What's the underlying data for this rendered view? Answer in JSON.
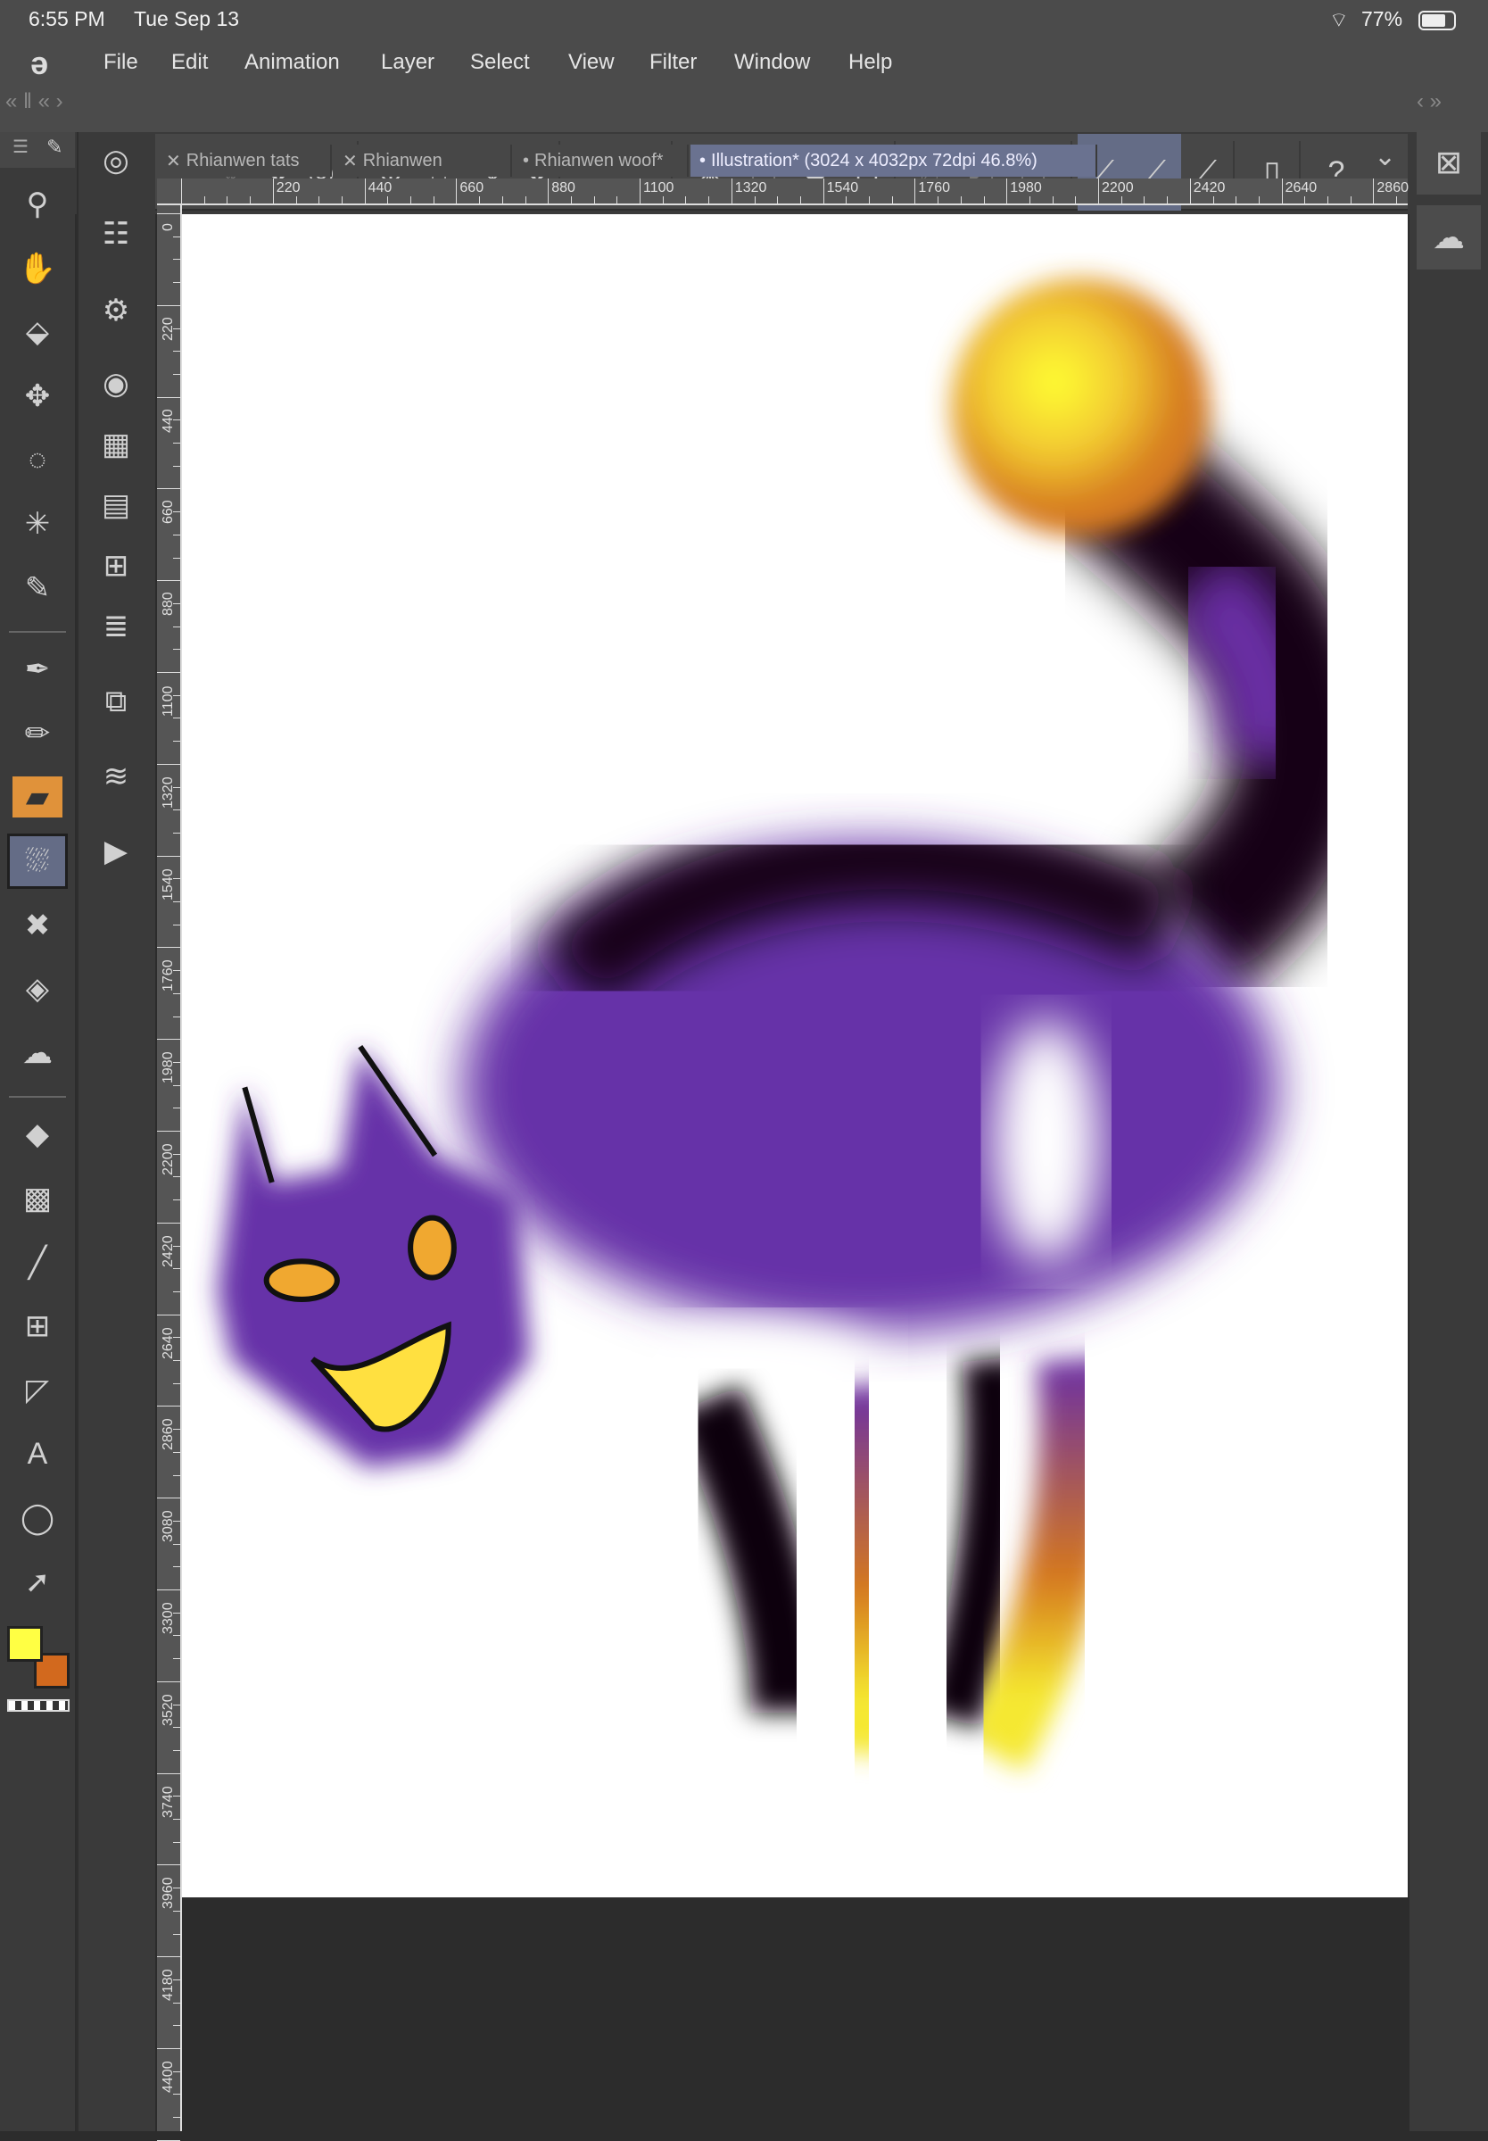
{
  "status": {
    "time": "6:55 PM",
    "date": "Tue Sep 13",
    "battery": "77%",
    "wifi_icon": "wifi-icon",
    "battery_icon": "battery-icon"
  },
  "menu": [
    "File",
    "Edit",
    "Animation",
    "Layer",
    "Select",
    "View",
    "Filter",
    "Window",
    "Help"
  ],
  "command_bar": [
    {
      "name": "menu-icon",
      "glyph": "☰"
    },
    {
      "name": "edit-layer-icon",
      "glyph": "✐",
      "dim": true
    },
    {
      "name": "updown-icon",
      "glyph": "⇕"
    },
    {
      "name": "clip-studio-sync-icon",
      "glyph": "◎"
    },
    {
      "name": "new-icon",
      "glyph": "⊕"
    },
    {
      "name": "open-icon",
      "glyph": "⌂"
    },
    {
      "name": "save-icon",
      "glyph": "⤓"
    },
    {
      "name": "updown-icon-2",
      "glyph": "⇕"
    },
    {
      "name": "undo-icon",
      "glyph": "↶"
    },
    {
      "name": "redo-icon",
      "glyph": "↷",
      "dim": true
    },
    {
      "name": "deselect-icon",
      "glyph": "✺"
    },
    {
      "name": "select-all-icon",
      "glyph": "⬚",
      "dim": true
    },
    {
      "name": "fill-icon",
      "glyph": "◆"
    },
    {
      "name": "transform-icon",
      "glyph": "⊡"
    },
    {
      "name": "clear-icon",
      "glyph": "⍁",
      "dim": true
    },
    {
      "name": "fill-selection-icon",
      "glyph": "◩",
      "dim": true
    },
    {
      "name": "border-icon",
      "glyph": "▢",
      "dim": true
    },
    {
      "name": "snap-ruler-icon",
      "glyph": "⟋",
      "hl": true
    },
    {
      "name": "snap-special-ruler-icon",
      "glyph": "⟋",
      "hl": true
    },
    {
      "name": "snap-grid-icon",
      "glyph": "⟋"
    },
    {
      "name": "device-icon",
      "glyph": "▯"
    },
    {
      "name": "help-icon",
      "glyph": "?"
    }
  ],
  "tabs": [
    {
      "label": "Rhianwen tats",
      "mark": "✕"
    },
    {
      "label": "Rhianwen",
      "mark": "✕"
    },
    {
      "label": "Rhianwen woof*",
      "mark": "•"
    },
    {
      "label": "Illustration* (3024 x 4032px 72dpi 46.8%)",
      "mark": "•",
      "active": true
    }
  ],
  "tabs_dropdown": "⌄",
  "ruler_h": [
    "220",
    "440",
    "660",
    "880",
    "1100",
    "1320",
    "1540",
    "1760",
    "1980",
    "2200",
    "2420",
    "2640",
    "2860"
  ],
  "ruler_v": [
    "0",
    "220",
    "440",
    "660",
    "880",
    "1100",
    "1320",
    "1540",
    "1760",
    "1980",
    "2200",
    "2420",
    "2640",
    "2860",
    "3080",
    "3300",
    "3520",
    "3740",
    "3960",
    "4180",
    "4400"
  ],
  "tools": [
    {
      "name": "zoom-tool",
      "glyph": "⚲"
    },
    {
      "name": "hand-tool",
      "glyph": "✋"
    },
    {
      "name": "object-tool",
      "glyph": "⬙"
    },
    {
      "name": "move-tool",
      "glyph": "✥"
    },
    {
      "name": "lasso-tool",
      "glyph": "◌"
    },
    {
      "name": "magic-wand-tool",
      "glyph": "✳"
    },
    {
      "name": "eyedropper-tool",
      "glyph": "✎"
    },
    {
      "divider": true
    },
    {
      "name": "pen-tool",
      "glyph": "✒"
    },
    {
      "name": "pencil-tool",
      "glyph": "✏"
    },
    {
      "name": "brush-tool",
      "glyph": "▰",
      "brush": true
    },
    {
      "name": "airbrush-tool",
      "glyph": "⛆",
      "sel": true
    },
    {
      "name": "decoration-tool",
      "glyph": "✖"
    },
    {
      "name": "eraser-tool",
      "glyph": "◈"
    },
    {
      "name": "blend-tool",
      "glyph": "☁"
    },
    {
      "divider": true
    },
    {
      "name": "fill-tool",
      "glyph": "◆"
    },
    {
      "name": "gradient-tool",
      "glyph": "▩"
    },
    {
      "name": "figure-tool",
      "glyph": "╱"
    },
    {
      "name": "frame-tool",
      "glyph": "⊞"
    },
    {
      "name": "ruler-tool",
      "glyph": "◸"
    },
    {
      "name": "text-tool",
      "glyph": "A"
    },
    {
      "name": "balloon-tool",
      "glyph": "◯"
    },
    {
      "name": "correct-line-tool",
      "glyph": "➚"
    }
  ],
  "subtools": [
    {
      "name": "tool-property-icon",
      "glyph": "◎"
    },
    {
      "name": "sub-tool-detail-icon",
      "glyph": "☷"
    },
    {
      "name": "brush-settings-icon",
      "glyph": "⚙"
    },
    {
      "name": "color-wheel-icon",
      "glyph": "◉"
    },
    {
      "name": "color-set-icon",
      "glyph": "▦"
    },
    {
      "name": "timeline-icon",
      "glyph": "▤"
    },
    {
      "name": "navigator-icon",
      "glyph": "⊞"
    },
    {
      "name": "layer-property-icon",
      "glyph": "≣"
    },
    {
      "name": "layer-search-icon",
      "glyph": "⧉"
    },
    {
      "name": "layers-icon",
      "glyph": "≋"
    },
    {
      "name": "animation-cels-icon",
      "glyph": "▶"
    }
  ],
  "colors": {
    "main": "#ffff44",
    "sub": "#d2691e",
    "active_tab": "#6a7290",
    "selected": "#646c86",
    "brush_tool": "#e0923a"
  },
  "right_panel": [
    {
      "name": "delete-layer-icon",
      "glyph": "⊠"
    },
    {
      "name": "blend-drops-icon",
      "glyph": "☁"
    }
  ]
}
